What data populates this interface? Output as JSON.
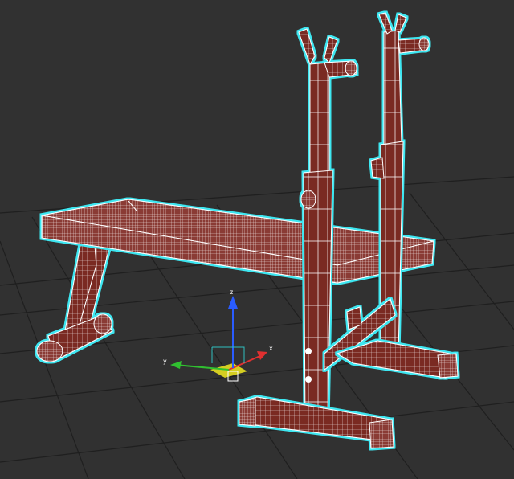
{
  "viewport": {
    "background": "#313131",
    "grid_color": "#1d1d1d",
    "wire_white": "#ffffff",
    "selection_glow": "#3ee6f0",
    "wood_fill": "#7a2a24",
    "wood_fill_dark": "#5c1d19"
  },
  "gizmo": {
    "x_label": "x",
    "y_label": "y",
    "z_label": "z",
    "x_color": "#e03030",
    "y_color": "#30c030",
    "z_color": "#2a5cff",
    "plane_color": "#e8e020"
  }
}
